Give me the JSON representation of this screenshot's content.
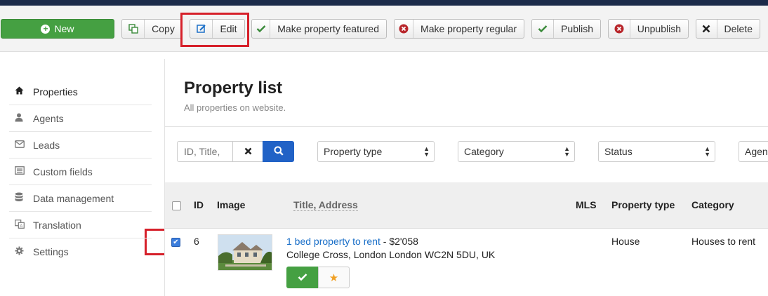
{
  "toolbar": {
    "new_label": "New",
    "copy_label": "Copy",
    "edit_label": "Edit",
    "featured_label": "Make property featured",
    "regular_label": "Make property regular",
    "publish_label": "Publish",
    "unpublish_label": "Unpublish",
    "delete_label": "Delete"
  },
  "sidebar": {
    "items": [
      {
        "label": "Properties",
        "icon": "home-icon"
      },
      {
        "label": "Agents",
        "icon": "user-icon"
      },
      {
        "label": "Leads",
        "icon": "envelope-icon"
      },
      {
        "label": "Custom fields",
        "icon": "list-icon"
      },
      {
        "label": "Data management",
        "icon": "database-icon"
      },
      {
        "label": "Translation",
        "icon": "translate-icon"
      },
      {
        "label": "Settings",
        "icon": "gear-icon"
      }
    ]
  },
  "page": {
    "title": "Property list",
    "subtitle": "All properties on website."
  },
  "filters": {
    "search_placeholder": "ID, Title,",
    "property_type": "Property type",
    "category": "Category",
    "status": "Status",
    "agent": "Agen"
  },
  "table": {
    "headers": {
      "id": "ID",
      "image": "Image",
      "title": "Title, Address",
      "mls": "MLS",
      "property_type": "Property type",
      "category": "Category"
    },
    "rows": [
      {
        "id": "6",
        "title": "1 bed property to rent",
        "price": " - $2'058",
        "address": "College Cross, London London WC2N 5DU, UK",
        "mls": "",
        "property_type": "House",
        "category": "Houses to rent",
        "checked": true
      }
    ]
  },
  "colors": {
    "new_button": "#45a042",
    "search_button": "#2162c6",
    "link": "#1a6fc8",
    "highlight": "#d6202a",
    "star": "#f0a024"
  }
}
